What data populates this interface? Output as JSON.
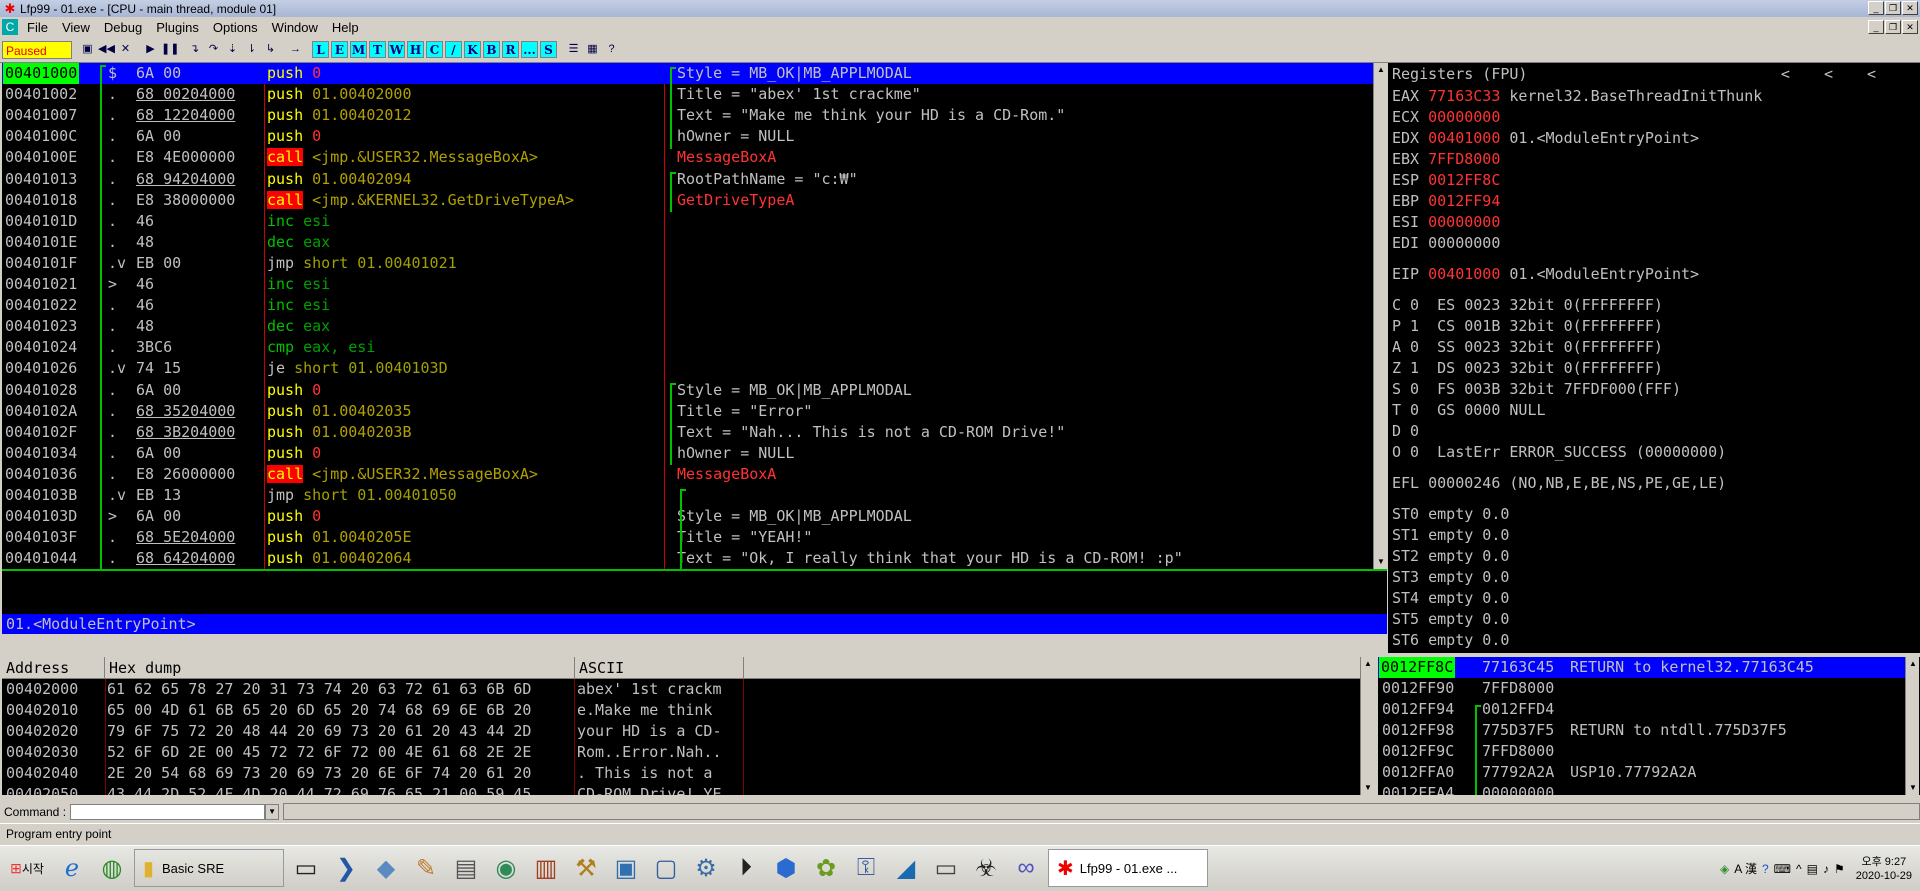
{
  "window": {
    "title": "Lfp99 - 01.exe - [CPU - main thread, module 01]"
  },
  "menu": [
    "File",
    "View",
    "Debug",
    "Plugins",
    "Options",
    "Window",
    "Help"
  ],
  "toolbar": {
    "status": "Paused",
    "letters": [
      "L",
      "E",
      "M",
      "T",
      "W",
      "H",
      "C",
      "/",
      "K",
      "B",
      "R",
      "...",
      "S"
    ]
  },
  "disasm": [
    {
      "addr": "00401000",
      "mark": "$",
      "hex": "6A 00",
      "op": "push",
      "arg": "0",
      "kind": "push",
      "cmt": "Style = MB_OK|MB_APPLMODAL",
      "sel": true
    },
    {
      "addr": "00401002",
      "mark": ".",
      "hex": "68 00204000",
      "op": "push",
      "arg": "01.00402000",
      "kind": "push",
      "cmt": "Title = \"abex' 1st crackme\""
    },
    {
      "addr": "00401007",
      "mark": ".",
      "hex": "68 12204000",
      "op": "push",
      "arg": "01.00402012",
      "kind": "push",
      "cmt": "Text = \"Make me think your HD is a CD-Rom.\""
    },
    {
      "addr": "0040100C",
      "mark": ".",
      "hex": "6A 00",
      "op": "push",
      "arg": "0",
      "kind": "push",
      "cmt": "hOwner = NULL"
    },
    {
      "addr": "0040100E",
      "mark": ".",
      "hex": "E8 4E000000",
      "op": "call",
      "arg": "<jmp.&USER32.MessageBoxA>",
      "kind": "call",
      "cmt": "MessageBoxA",
      "cmtred": true
    },
    {
      "addr": "00401013",
      "mark": ".",
      "hex": "68 94204000",
      "op": "push",
      "arg": "01.00402094",
      "kind": "push",
      "cmt": "RootPathName = \"c:₩\""
    },
    {
      "addr": "00401018",
      "mark": ".",
      "hex": "E8 38000000",
      "op": "call",
      "arg": "<jmp.&KERNEL32.GetDriveTypeA>",
      "kind": "call",
      "cmt": "GetDriveTypeA",
      "cmtred": true
    },
    {
      "addr": "0040101D",
      "mark": ".",
      "hex": "46",
      "op": "inc",
      "arg": "esi",
      "kind": "green",
      "cmt": ""
    },
    {
      "addr": "0040101E",
      "mark": ".",
      "hex": "48",
      "op": "dec",
      "arg": "eax",
      "kind": "green",
      "cmt": ""
    },
    {
      "addr": "0040101F",
      "mark": ".v",
      "hex": "EB 00",
      "op": "jmp",
      "arg": "short 01.00401021",
      "kind": "jmp",
      "cmt": ""
    },
    {
      "addr": "00401021",
      "mark": ">",
      "hex": "46",
      "op": "inc",
      "arg": "esi",
      "kind": "green",
      "cmt": ""
    },
    {
      "addr": "00401022",
      "mark": ".",
      "hex": "46",
      "op": "inc",
      "arg": "esi",
      "kind": "green",
      "cmt": ""
    },
    {
      "addr": "00401023",
      "mark": ".",
      "hex": "48",
      "op": "dec",
      "arg": "eax",
      "kind": "green",
      "cmt": ""
    },
    {
      "addr": "00401024",
      "mark": ".",
      "hex": "3BC6",
      "op": "cmp",
      "arg": "eax, esi",
      "kind": "green",
      "cmt": ""
    },
    {
      "addr": "00401026",
      "mark": ".v",
      "hex": "74 15",
      "op": "je",
      "arg": "short 01.0040103D",
      "kind": "jmp",
      "cmt": ""
    },
    {
      "addr": "00401028",
      "mark": ".",
      "hex": "6A 00",
      "op": "push",
      "arg": "0",
      "kind": "push",
      "cmt": "Style = MB_OK|MB_APPLMODAL"
    },
    {
      "addr": "0040102A",
      "mark": ".",
      "hex": "68 35204000",
      "op": "push",
      "arg": "01.00402035",
      "kind": "push",
      "cmt": "Title = \"Error\""
    },
    {
      "addr": "0040102F",
      "mark": ".",
      "hex": "68 3B204000",
      "op": "push",
      "arg": "01.0040203B",
      "kind": "push",
      "cmt": "Text = \"Nah... This is not a CD-ROM Drive!\""
    },
    {
      "addr": "00401034",
      "mark": ".",
      "hex": "6A 00",
      "op": "push",
      "arg": "0",
      "kind": "push",
      "cmt": "hOwner = NULL"
    },
    {
      "addr": "00401036",
      "mark": ".",
      "hex": "E8 26000000",
      "op": "call",
      "arg": "<jmp.&USER32.MessageBoxA>",
      "kind": "call",
      "cmt": "MessageBoxA",
      "cmtred": true
    },
    {
      "addr": "0040103B",
      "mark": ".v",
      "hex": "EB 13",
      "op": "jmp",
      "arg": "short 01.00401050",
      "kind": "jmp",
      "cmt": ""
    },
    {
      "addr": "0040103D",
      "mark": ">",
      "hex": "6A 00",
      "op": "push",
      "arg": "0",
      "kind": "push",
      "cmt": "Style = MB_OK|MB_APPLMODAL"
    },
    {
      "addr": "0040103F",
      "mark": ".",
      "hex": "68 5E204000",
      "op": "push",
      "arg": "01.0040205E",
      "kind": "push",
      "cmt": "Title = \"YEAH!\""
    },
    {
      "addr": "00401044",
      "mark": ".",
      "hex": "68 64204000",
      "op": "push",
      "arg": "01.00402064",
      "kind": "push",
      "cmt": "Text = \"Ok, I really think that your HD is a CD-ROM! :p\""
    }
  ],
  "info": {
    "entry": "01.<ModuleEntryPoint>"
  },
  "registers": {
    "header": "Registers (FPU)",
    "arrows": [
      "<",
      "<",
      "<"
    ],
    "gp": [
      {
        "name": "EAX",
        "val": "77163C33",
        "red": true,
        "note": "kernel32.BaseThreadInitThunk"
      },
      {
        "name": "ECX",
        "val": "00000000",
        "red": true,
        "note": ""
      },
      {
        "name": "EDX",
        "val": "00401000",
        "red": true,
        "note": "01.<ModuleEntryPoint>"
      },
      {
        "name": "EBX",
        "val": "7FFD8000",
        "red": true,
        "note": ""
      },
      {
        "name": "ESP",
        "val": "0012FF8C",
        "red": true,
        "note": ""
      },
      {
        "name": "EBP",
        "val": "0012FF94",
        "red": true,
        "note": ""
      },
      {
        "name": "ESI",
        "val": "00000000",
        "red": true,
        "note": ""
      },
      {
        "name": "EDI",
        "val": "00000000",
        "red": false,
        "note": ""
      }
    ],
    "eip": {
      "name": "EIP",
      "val": "00401000",
      "note": "01.<ModuleEntryPoint>"
    },
    "flags": [
      "C 0  ES 0023 32bit 0(FFFFFFFF)",
      "P 1  CS 001B 32bit 0(FFFFFFFF)",
      "A 0  SS 0023 32bit 0(FFFFFFFF)",
      "Z 1  DS 0023 32bit 0(FFFFFFFF)",
      "S 0  FS 003B 32bit 7FFDF000(FFF)",
      "T 0  GS 0000 NULL",
      "D 0",
      "O 0  LastErr ERROR_SUCCESS (00000000)"
    ],
    "efl": "EFL 00000246 (NO,NB,E,BE,NS,PE,GE,LE)",
    "fpu": [
      "ST0 empty 0.0",
      "ST1 empty 0.0",
      "ST2 empty 0.0",
      "ST3 empty 0.0",
      "ST4 empty 0.0",
      "ST5 empty 0.0",
      "ST6 empty 0.0"
    ]
  },
  "dump": {
    "headers": [
      "Address",
      "Hex dump",
      "ASCII"
    ],
    "rows": [
      {
        "addr": "00402000",
        "hex": "61 62 65 78 27 20 31 73 74 20 63 72 61 63 6B 6D",
        "ascii": "abex' 1st crackm"
      },
      {
        "addr": "00402010",
        "hex": "65 00 4D 61 6B 65 20 6D 65 20 74 68 69 6E 6B 20",
        "ascii": "e.Make me think "
      },
      {
        "addr": "00402020",
        "hex": "79 6F 75 72 20 48 44 20 69 73 20 61 20 43 44 2D",
        "ascii": "your HD is a CD-"
      },
      {
        "addr": "00402030",
        "hex": "52 6F 6D 2E 00 45 72 72 6F 72 00 4E 61 68 2E 2E",
        "ascii": "Rom..Error.Nah.."
      },
      {
        "addr": "00402040",
        "hex": "2E 20 54 68 69 73 20 69 73 20 6E 6F 74 20 61 20",
        "ascii": ". This is not a "
      },
      {
        "addr": "00402050",
        "hex": "43 44 2D 52 4F 4D 20 44 72 69 76 65 21 00 59 45",
        "ascii": "CD-ROM Drive!.YE"
      }
    ]
  },
  "stack": [
    {
      "addr": "0012FF8C",
      "val": "77163C45",
      "cmt": "RETURN to kernel32.77163C45",
      "sel": true
    },
    {
      "addr": "0012FF90",
      "val": "7FFD8000",
      "cmt": ""
    },
    {
      "addr": "0012FF94",
      "val": "0012FFD4",
      "cmt": ""
    },
    {
      "addr": "0012FF98",
      "val": "775D37F5",
      "cmt": "RETURN to ntdll.775D37F5"
    },
    {
      "addr": "0012FF9C",
      "val": "7FFD8000",
      "cmt": ""
    },
    {
      "addr": "0012FFA0",
      "val": "77792A2A",
      "cmt": "USP10.77792A2A"
    },
    {
      "addr": "0012FFA4",
      "val": "00000000",
      "cmt": ""
    }
  ],
  "command": {
    "label": "Command :",
    "value": ""
  },
  "status": {
    "text": "Program entry point"
  },
  "taskbar": {
    "start": "시작",
    "tasks": [
      {
        "label": "Basic SRE",
        "icon": "folder-icon"
      },
      {
        "label": "Lfp99 - 01.exe ...",
        "icon": "bug-icon"
      }
    ],
    "tray_ime": "A 漢",
    "time": "오후 9:27",
    "date": "2020-10-29"
  },
  "colors": {
    "selection": "#0000ff",
    "entry": "#00ff00",
    "push": "#ffff00",
    "call_bg": "#ff0000",
    "red_value": "#ff3333"
  }
}
